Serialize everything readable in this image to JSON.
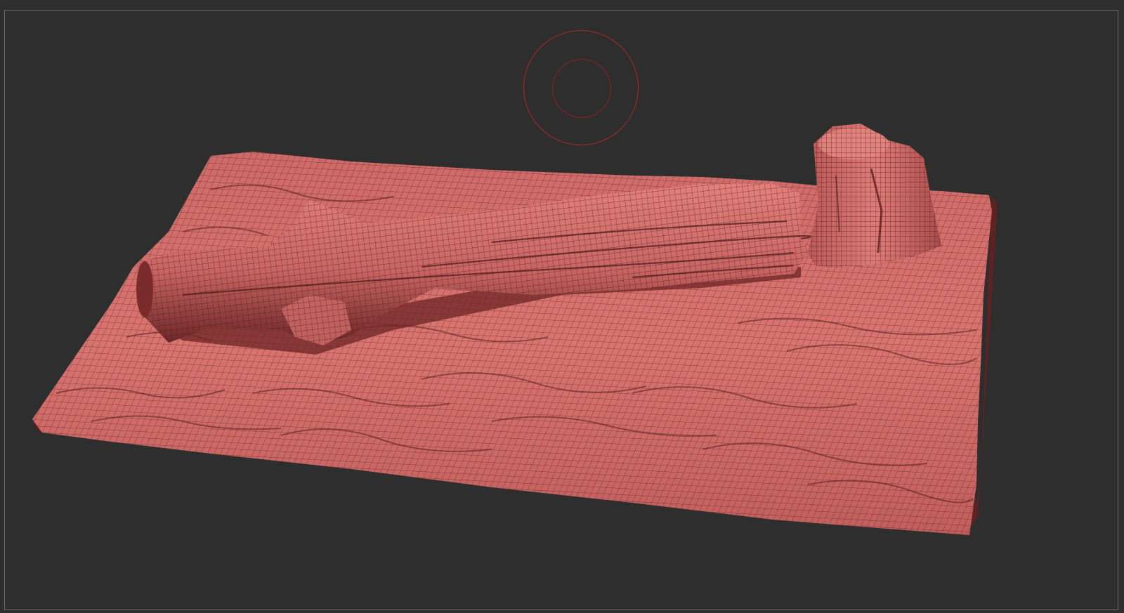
{
  "viewport": {
    "background_color": "#2e2e2e",
    "frame_color": "#6a6a6a"
  },
  "mesh": {
    "material_color": "#d8706e",
    "shadow_color": "#5a1e1e",
    "wire_color": "#3a1414",
    "description_icon": "sculpt-mesh-icon"
  },
  "brush": {
    "outer_ring_color": "#b02828",
    "inner_ring_color": "#8a2424"
  }
}
